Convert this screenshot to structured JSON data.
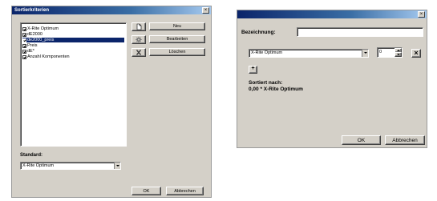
{
  "dialog_left": {
    "title": "Sortierkriterien",
    "criteria": [
      {
        "label": "X-Rite Optimum",
        "checked": true,
        "selected": false
      },
      {
        "label": "dE2000",
        "checked": true,
        "selected": false
      },
      {
        "label": "de2000_preis",
        "checked": true,
        "selected": true
      },
      {
        "label": "Preis",
        "checked": true,
        "selected": false
      },
      {
        "label": "dE*",
        "checked": true,
        "selected": false
      },
      {
        "label": "Anzahl Komponenten",
        "checked": true,
        "selected": false
      }
    ],
    "new_label": "Neu",
    "edit_label": "Bearbeiten",
    "delete_label": "Löschen",
    "standard_label": "Standard:",
    "standard_value": "X-Rite Optimum",
    "ok_label": "OK",
    "cancel_label": "Abbrechen"
  },
  "dialog_right": {
    "title": "",
    "name_label": "Bezeichnung:",
    "name_value": "",
    "criterion_value": "X-Rite Optimum",
    "weight_value": "0",
    "add_label": "+",
    "remove_label": "×",
    "sorted_by_label": "Sortiert nach:",
    "sorted_by_value": "0,00 * X-Rite Optimum",
    "ok_label": "OK",
    "cancel_label": "Abbrechen"
  }
}
